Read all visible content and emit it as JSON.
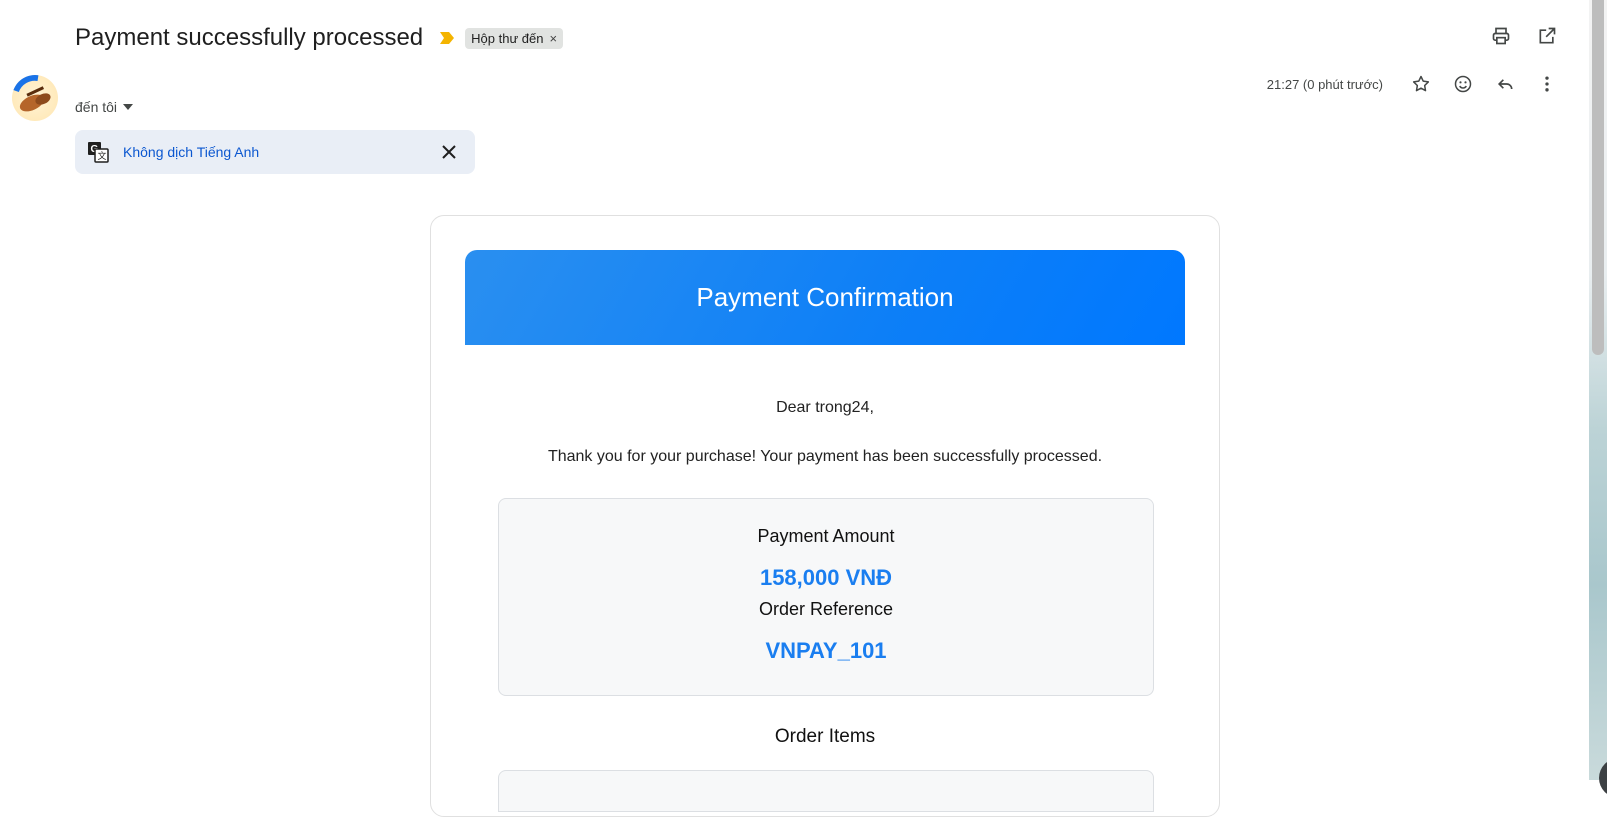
{
  "header": {
    "subject": "Payment successfully processed",
    "label_chip": "Hộp thư đến",
    "label_chip_remove": "×"
  },
  "sender": {
    "recipient": "đến tôi",
    "timestamp": "21:27 (0 phút trước)"
  },
  "translate_bar": {
    "link": "Không dịch Tiếng Anh"
  },
  "email": {
    "hero_title": "Payment Confirmation",
    "greeting": "Dear trong24,",
    "thanks": "Thank you for your purchase! Your payment has been successfully processed.",
    "amount_label": "Payment Amount",
    "amount_value": "158,000 VNĐ",
    "reference_label": "Order Reference",
    "reference_value": "VNPAY_101",
    "items_heading": "Order Items"
  },
  "colors": {
    "accent_blue": "#1a7ef0",
    "hero_blue": "#0d7ff7",
    "link_blue": "#0b57d0",
    "importance_yellow": "#f4b400"
  },
  "icons": {
    "top": [
      "print-icon",
      "open-in-new-window-icon"
    ],
    "meta": [
      "star-icon",
      "emoji-reaction-icon",
      "reply-icon",
      "more-vert-icon"
    ]
  }
}
